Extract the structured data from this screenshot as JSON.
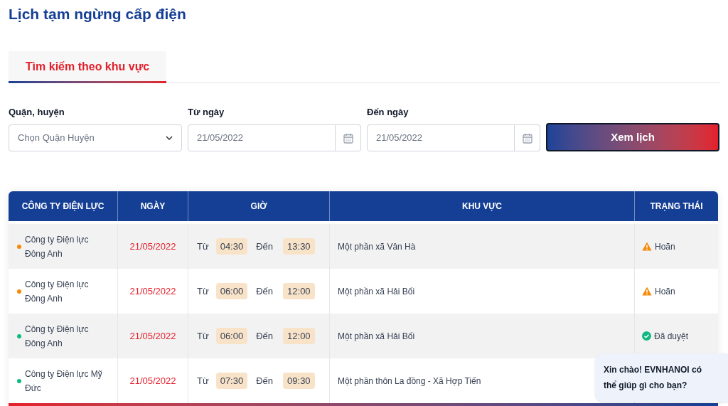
{
  "title": "Lịch tạm ngừng cấp điện",
  "tabs": [
    {
      "label": "Tìm kiếm theo khu vực",
      "selected": true
    }
  ],
  "form": {
    "district": {
      "label": "Quận, huyện",
      "value": "Chọn Quận Huyện"
    },
    "from_date": {
      "label": "Từ ngày",
      "value": "21/05/2022"
    },
    "to_date": {
      "label": "Đến ngày",
      "value": "21/05/2022"
    },
    "submit": "Xem lịch"
  },
  "table": {
    "columns": [
      "CÔNG TY ĐIỆN LỰC",
      "NGÀY",
      "GIỜ",
      "KHU VỰC",
      "TRẠNG THÁI"
    ],
    "rows": [
      {
        "company": "Công ty Điện lực Đông Anh",
        "color": "#f58a07",
        "date": "21/05/2022",
        "from_label": "Từ",
        "from": "04:30",
        "to_label": "Đến",
        "to": "13:30",
        "area": "Một phần xã Vân Hà",
        "status": {
          "kind": "postponed",
          "label": "Hoãn"
        }
      },
      {
        "company": "Công ty Điện lực Đông Anh",
        "color": "#f58a07",
        "date": "21/05/2022",
        "from_label": "Từ",
        "from": "06:00",
        "to_label": "Đến",
        "to": "12:00",
        "area": "Một phần xã Hải Bối",
        "status": {
          "kind": "postponed",
          "label": "Hoãn"
        }
      },
      {
        "company": "Công ty Điện lực Đông Anh",
        "color": "#10b981",
        "date": "21/05/2022",
        "from_label": "Từ",
        "from": "06:00",
        "to_label": "Đến",
        "to": "12:00",
        "area": "Một phần xã Hải Bối",
        "status": {
          "kind": "approved",
          "label": "Đã duyệt"
        }
      },
      {
        "company": "Công ty Điện lực Mỹ Đức",
        "color": "#10b981",
        "date": "21/05/2022",
        "from_label": "Từ",
        "from": "07:30",
        "to_label": "Đến",
        "to": "09:30",
        "area": "Một phần thôn La đồng - Xã Hợp Tiến"
      }
    ]
  },
  "chat_bubble": "Xin chào! EVNHANOI có thể giúp gì cho bạn?"
}
